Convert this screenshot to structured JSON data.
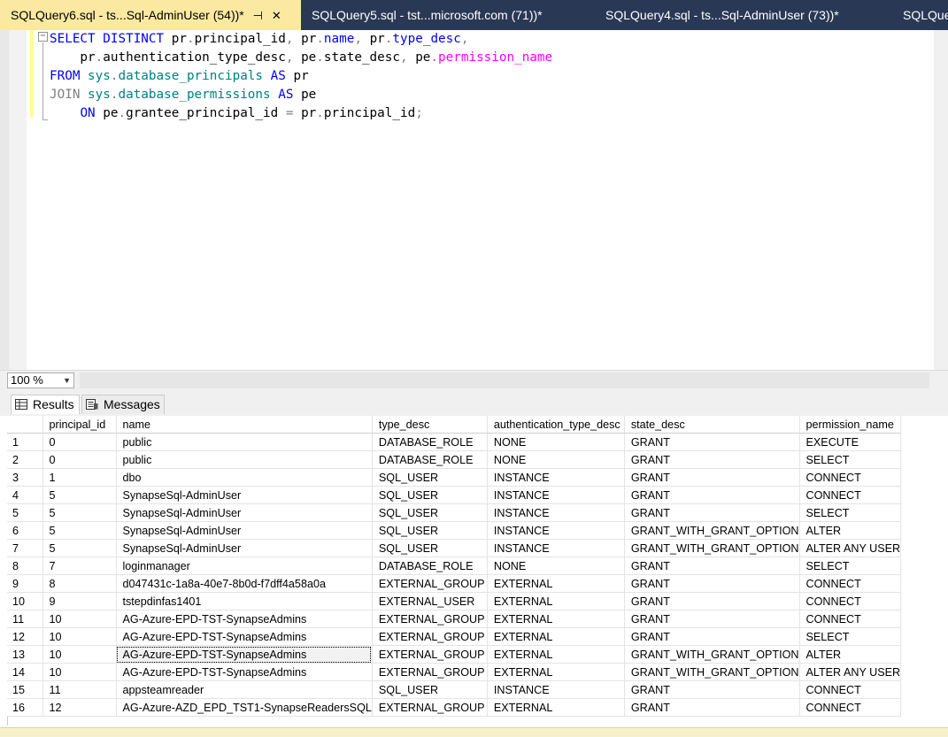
{
  "tabs": [
    {
      "title": "SQLQuery6.sql - ts...Sql-AdminUser (54))*",
      "active": true
    },
    {
      "title": "SQLQuery5.sql - tst...microsoft.com (71))*",
      "active": false
    },
    {
      "title": "SQLQuery4.sql - ts...Sql-AdminUser (73))*",
      "active": false
    },
    {
      "title": "SQLQue",
      "active": false
    }
  ],
  "tab_pin_glyph": "⊣",
  "tab_close_glyph": "✕",
  "editor": {
    "collapse_glyph": "−",
    "lines": [
      [
        {
          "t": "SELECT",
          "c": "kw"
        },
        {
          "t": " "
        },
        {
          "t": "DISTINCT",
          "c": "kw"
        },
        {
          "t": " pr"
        },
        {
          "t": ".",
          "c": "kg"
        },
        {
          "t": "principal_id"
        },
        {
          "t": ",",
          "c": "kg"
        },
        {
          "t": " pr"
        },
        {
          "t": ".",
          "c": "kg"
        },
        {
          "t": "name",
          "c": "kw"
        },
        {
          "t": ",",
          "c": "kg"
        },
        {
          "t": " pr"
        },
        {
          "t": ".",
          "c": "kg"
        },
        {
          "t": "type_desc",
          "c": "kw"
        },
        {
          "t": ",",
          "c": "kg"
        }
      ],
      [
        {
          "t": "    pr"
        },
        {
          "t": ".",
          "c": "kg"
        },
        {
          "t": "authentication_type_desc"
        },
        {
          "t": ",",
          "c": "kg"
        },
        {
          "t": " pe"
        },
        {
          "t": ".",
          "c": "kg"
        },
        {
          "t": "state_desc"
        },
        {
          "t": ",",
          "c": "kg"
        },
        {
          "t": " pe"
        },
        {
          "t": ".",
          "c": "kg"
        },
        {
          "t": "permission_name",
          "c": "fn"
        }
      ],
      [
        {
          "t": "FROM",
          "c": "kw"
        },
        {
          "t": " "
        },
        {
          "t": "sys",
          "c": "sys"
        },
        {
          "t": ".",
          "c": "kg"
        },
        {
          "t": "database_principals",
          "c": "sys"
        },
        {
          "t": " "
        },
        {
          "t": "AS",
          "c": "kw"
        },
        {
          "t": " pr"
        }
      ],
      [
        {
          "t": "JOIN",
          "c": "kg"
        },
        {
          "t": " "
        },
        {
          "t": "sys",
          "c": "sys"
        },
        {
          "t": ".",
          "c": "kg"
        },
        {
          "t": "database_permissions",
          "c": "sys"
        },
        {
          "t": " "
        },
        {
          "t": "AS",
          "c": "kw"
        },
        {
          "t": " pe"
        }
      ],
      [
        {
          "t": "    "
        },
        {
          "t": "ON",
          "c": "kw"
        },
        {
          "t": " pe"
        },
        {
          "t": ".",
          "c": "kg"
        },
        {
          "t": "grantee_principal_id"
        },
        {
          "t": " "
        },
        {
          "t": "=",
          "c": "kg"
        },
        {
          "t": " pr"
        },
        {
          "t": ".",
          "c": "kg"
        },
        {
          "t": "principal_id"
        },
        {
          "t": ";",
          "c": "kg"
        }
      ]
    ]
  },
  "zoom": {
    "value": "100 %",
    "arrow": "▼"
  },
  "result_tabs": {
    "results": "Results",
    "messages": "Messages"
  },
  "grid": {
    "columns": [
      "principal_id",
      "name",
      "type_desc",
      "authentication_type_desc",
      "state_desc",
      "permission_name"
    ],
    "rows": [
      [
        "1",
        "0",
        "public",
        "DATABASE_ROLE",
        "NONE",
        "GRANT",
        "EXECUTE"
      ],
      [
        "2",
        "0",
        "public",
        "DATABASE_ROLE",
        "NONE",
        "GRANT",
        "SELECT"
      ],
      [
        "3",
        "1",
        "dbo",
        "SQL_USER",
        "INSTANCE",
        "GRANT",
        "CONNECT"
      ],
      [
        "4",
        "5",
        "SynapseSql-AdminUser",
        "SQL_USER",
        "INSTANCE",
        "GRANT",
        "CONNECT"
      ],
      [
        "5",
        "5",
        "SynapseSql-AdminUser",
        "SQL_USER",
        "INSTANCE",
        "GRANT",
        "SELECT"
      ],
      [
        "6",
        "5",
        "SynapseSql-AdminUser",
        "SQL_USER",
        "INSTANCE",
        "GRANT_WITH_GRANT_OPTION",
        "ALTER"
      ],
      [
        "7",
        "5",
        "SynapseSql-AdminUser",
        "SQL_USER",
        "INSTANCE",
        "GRANT_WITH_GRANT_OPTION",
        "ALTER ANY USER"
      ],
      [
        "8",
        "7",
        "loginmanager",
        "DATABASE_ROLE",
        "NONE",
        "GRANT",
        "SELECT"
      ],
      [
        "9",
        "8",
        "d047431c-1a8a-40e7-8b0d-f7dff4a58a0a",
        "EXTERNAL_GROUP",
        "EXTERNAL",
        "GRANT",
        "CONNECT"
      ],
      [
        "10",
        "9",
        "tstepdinfas1401",
        "EXTERNAL_USER",
        "EXTERNAL",
        "GRANT",
        "CONNECT"
      ],
      [
        "11",
        "10",
        "AG-Azure-EPD-TST-SynapseAdmins",
        "EXTERNAL_GROUP",
        "EXTERNAL",
        "GRANT",
        "CONNECT"
      ],
      [
        "12",
        "10",
        "AG-Azure-EPD-TST-SynapseAdmins",
        "EXTERNAL_GROUP",
        "EXTERNAL",
        "GRANT",
        "SELECT"
      ],
      [
        "13",
        "10",
        "AG-Azure-EPD-TST-SynapseAdmins",
        "EXTERNAL_GROUP",
        "EXTERNAL",
        "GRANT_WITH_GRANT_OPTION",
        "ALTER"
      ],
      [
        "14",
        "10",
        "AG-Azure-EPD-TST-SynapseAdmins",
        "EXTERNAL_GROUP",
        "EXTERNAL",
        "GRANT_WITH_GRANT_OPTION",
        "ALTER ANY USER"
      ],
      [
        "15",
        "11",
        "appsteamreader",
        "SQL_USER",
        "INSTANCE",
        "GRANT",
        "CONNECT"
      ],
      [
        "16",
        "12",
        "AG-Azure-AZD_EPD_TST1-SynapseReadersSQL",
        "EXTERNAL_GROUP",
        "EXTERNAL",
        "GRANT",
        "CONNECT"
      ]
    ],
    "selected_cell": {
      "row": 13,
      "column": "name"
    }
  },
  "colors": {
    "tabbar": "#293955",
    "active_tab": "#fbe9a1",
    "keyword": "#0000ff",
    "system_object": "#008080",
    "function": "#ff00ff",
    "operator": "#808080"
  }
}
